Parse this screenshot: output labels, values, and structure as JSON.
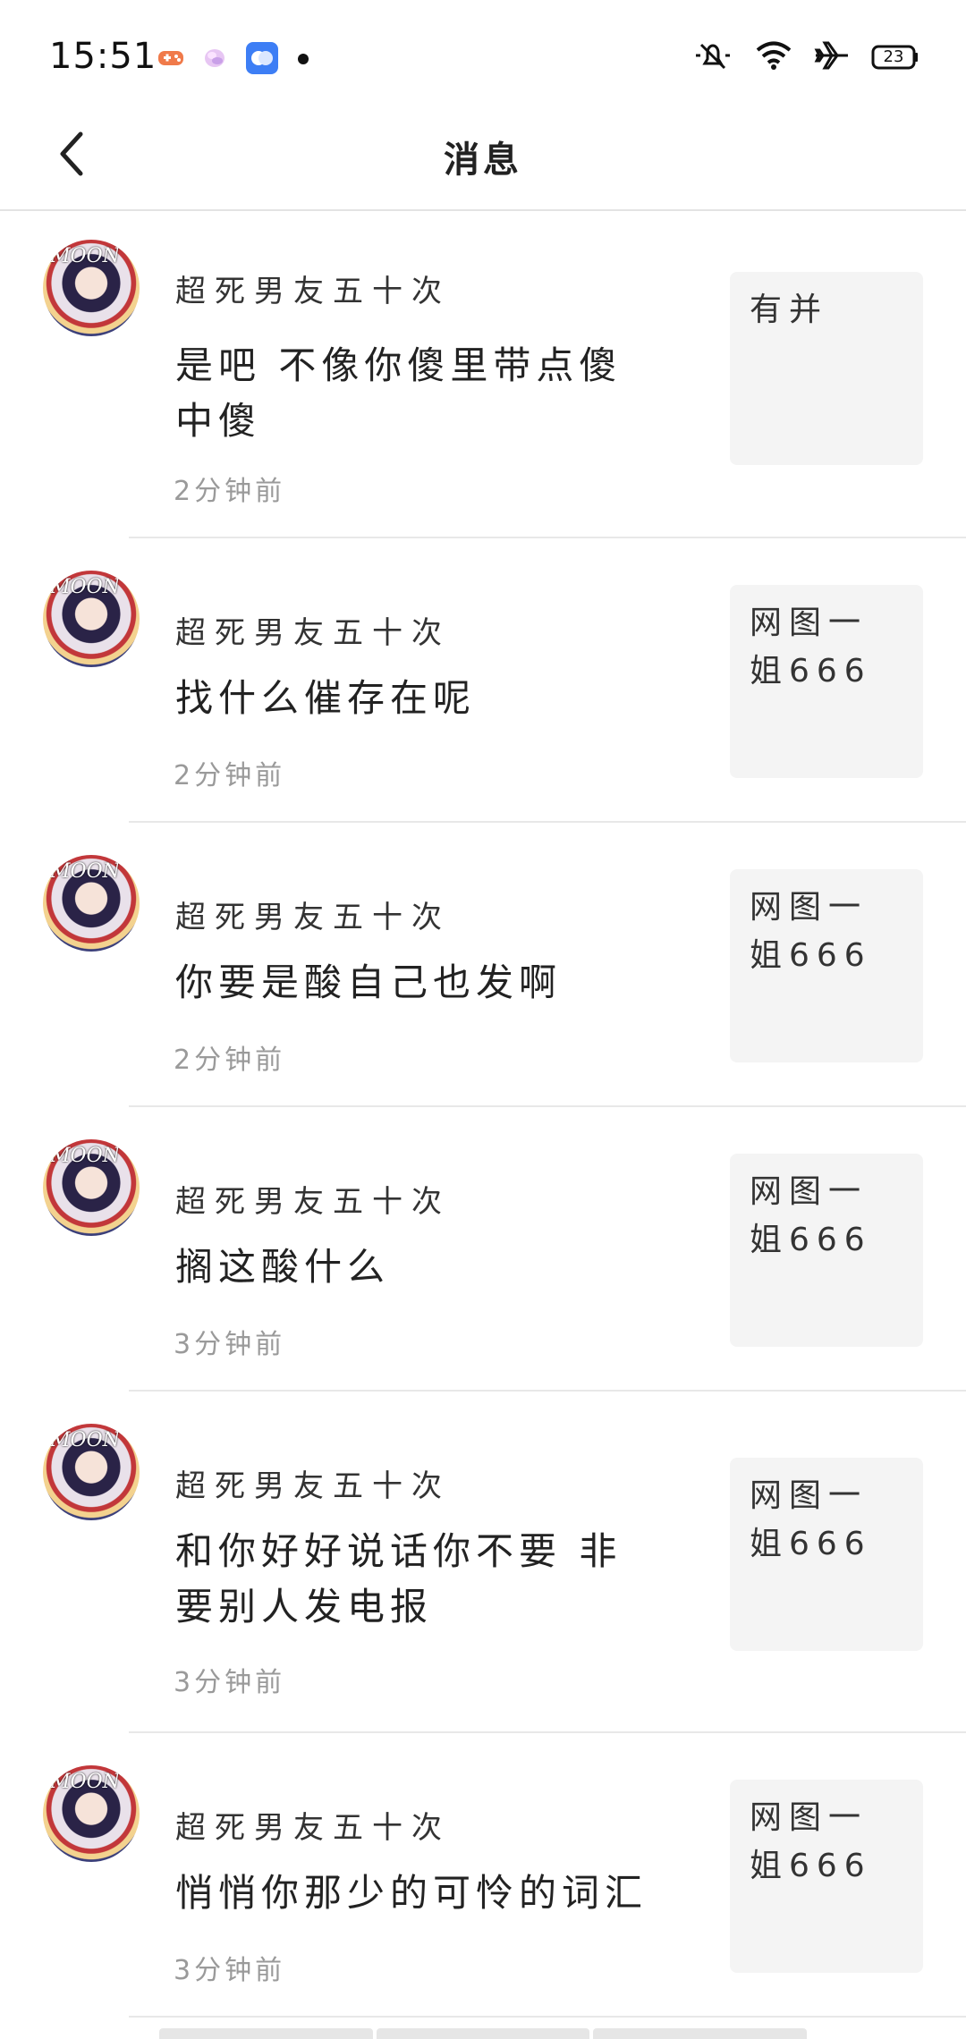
{
  "status_bar": {
    "time": "15:51",
    "battery": "23",
    "left_icons": [
      "game-app-icon",
      "bubble-app-icon",
      "chat-app-icon",
      "dot-icon"
    ],
    "right_icons": [
      "mute-bell-icon",
      "wifi-icon",
      "airplane-icon",
      "battery-icon"
    ]
  },
  "header": {
    "title": "消息"
  },
  "messages": [
    {
      "name": "超死男友五十次",
      "text": "是吧 不像你傻里带点傻中傻",
      "time": "2分钟前",
      "ref": "有并"
    },
    {
      "name": "超死男友五十次",
      "text": "找什么催存在呢",
      "time": "2分钟前",
      "ref": "网图一姐666"
    },
    {
      "name": "超死男友五十次",
      "text": "你要是酸自己也发啊",
      "time": "2分钟前",
      "ref": "网图一姐666"
    },
    {
      "name": "超死男友五十次",
      "text": "搁这酸什么",
      "time": "3分钟前",
      "ref": "网图一姐666"
    },
    {
      "name": "超死男友五十次",
      "text": "和你好好说话你不要 非要别人发电报",
      "time": "3分钟前",
      "ref": "网图一姐666"
    },
    {
      "name": "超死男友五十次",
      "text": "悄悄你那少的可怜的词汇",
      "time": "3分钟前",
      "ref": "网图一姐666"
    }
  ],
  "colors": {
    "background": "#ffffff",
    "ref_box": "#f4f4f4",
    "time_text": "#9a9a9a",
    "divider": "#e8e8e8"
  }
}
